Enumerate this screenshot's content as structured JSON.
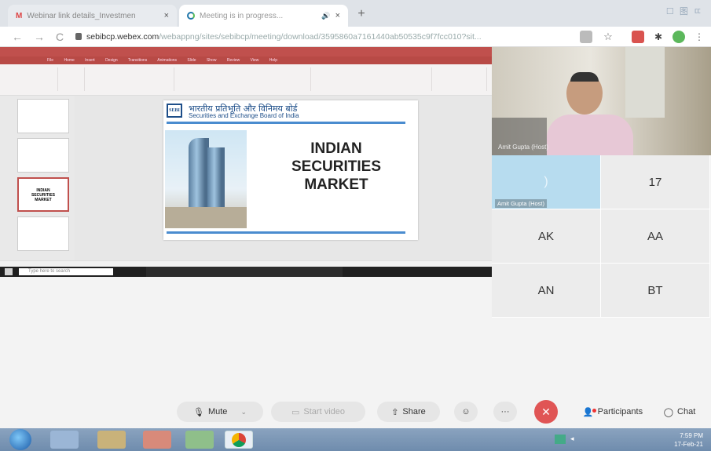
{
  "browser": {
    "tabs": [
      {
        "title": "Webinar link details_Investmen",
        "icon": "gmail-icon",
        "close": "×"
      },
      {
        "title": "Meeting is in progress...",
        "icon": "webex-icon",
        "close": "×",
        "audio": "🔊"
      }
    ],
    "new_tab": "+",
    "window_controls": "☐ 图 ㄸ",
    "nav": {
      "back": "←",
      "forward": "→",
      "reload": "C"
    },
    "url_domain": "sebibcp.webex.com",
    "url_path": "/webappng/sites/sebibcp/meeting/download/3595860a7161440ab50535c9f7fcc010?sit..."
  },
  "presentation": {
    "ribbon_tabs": "File Home Insert Design Transitions Animations Slide Show Review View Help",
    "slide": {
      "logo_text": "SEBI",
      "org_hindi": "भारतीय प्रतिभूति और विनिमय बोर्ड",
      "org_english": "Securities and Exchange Board of India",
      "title_lines": [
        "INDIAN",
        "SECURITIES",
        "MARKET"
      ]
    },
    "thumb_titles": [
      "INDIAN",
      "SECURITIES",
      "MARKET"
    ],
    "taskbar_search": "Type here to search"
  },
  "video": {
    "host_name": "Amit Gupta (Host)",
    "tiles": [
      {
        "label": "",
        "active": true,
        "host_label": "Amit Gupta (Host)"
      },
      {
        "label": "17"
      },
      {
        "label": "AK"
      },
      {
        "label": "AA"
      },
      {
        "label": "AN"
      },
      {
        "label": "BT"
      }
    ]
  },
  "controls": {
    "mute": "Mute",
    "video": "Start video",
    "share": "Share",
    "participants": "Participants",
    "chat": "Chat"
  },
  "os_taskbar": {
    "time": "7:59 PM",
    "date": "17-Feb-21"
  },
  "colors": {
    "end_button": "#e05555",
    "ppt_accent": "#c0504d",
    "sebi_blue": "#1d4e89"
  }
}
